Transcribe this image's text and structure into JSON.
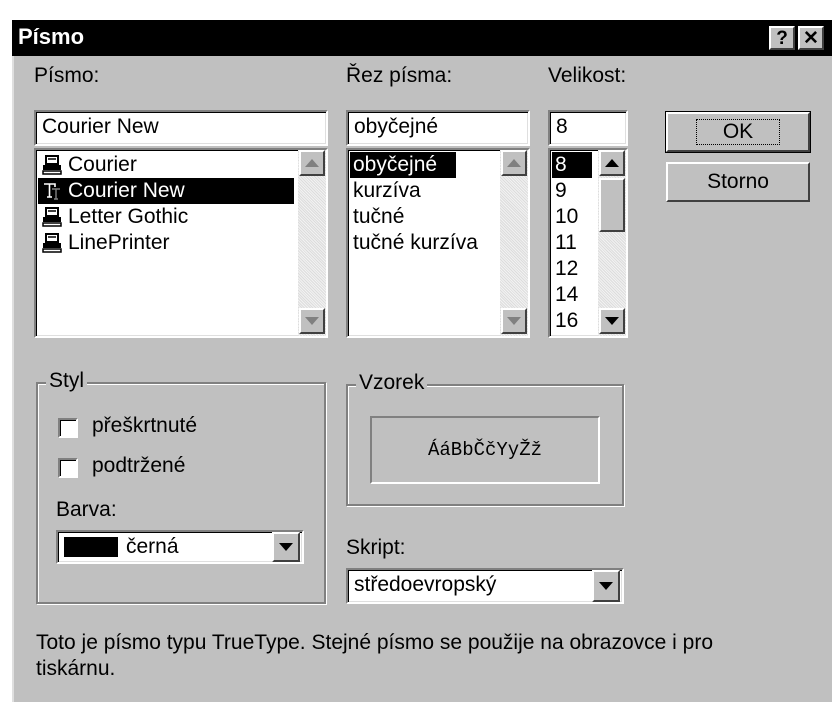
{
  "window": {
    "title": "Písmo",
    "help_button": "?",
    "close_button": "✕"
  },
  "font": {
    "label": "Písmo:",
    "label_underline": "P",
    "value": "Courier New",
    "items": [
      {
        "label": "Courier",
        "icon": "printer-font-icon",
        "selected": false
      },
      {
        "label": "Courier New",
        "icon": "truetype-font-icon",
        "selected": true
      },
      {
        "label": "Letter Gothic",
        "icon": "printer-font-icon",
        "selected": false
      },
      {
        "label": "LinePrinter",
        "icon": "printer-font-icon",
        "selected": false
      }
    ]
  },
  "style": {
    "label": "Řez písma:",
    "value": "obyčejné",
    "items": [
      {
        "label": "obyčejné",
        "selected": true
      },
      {
        "label": "kurzíva",
        "selected": false
      },
      {
        "label": "tučné",
        "selected": false
      },
      {
        "label": "tučné kurzíva",
        "selected": false
      }
    ]
  },
  "size": {
    "label": "Velikost:",
    "value": "8",
    "items": [
      {
        "label": "8",
        "selected": true
      },
      {
        "label": "9",
        "selected": false
      },
      {
        "label": "10",
        "selected": false
      },
      {
        "label": "11",
        "selected": false
      },
      {
        "label": "12",
        "selected": false
      },
      {
        "label": "14",
        "selected": false
      },
      {
        "label": "16",
        "selected": false
      }
    ]
  },
  "buttons": {
    "ok": "OK",
    "cancel": "Storno"
  },
  "effects": {
    "title": "Styl",
    "strikeout": "přeškrtnuté",
    "strikeout_checked": false,
    "underline": "podtržené",
    "underline_checked": false,
    "color_label": "Barva:",
    "color_value": "černá",
    "color_swatch": "#000000"
  },
  "sample": {
    "title": "Vzorek",
    "text": "ÁáBbČčYyŽž"
  },
  "script": {
    "label": "Skript:",
    "value": "středoevropský"
  },
  "description": "Toto je písmo typu TrueType. Stejné písmo se použije na obrazovce i pro tiskárnu.",
  "colors": {
    "dialog_bg": "#c0c0c0",
    "titlebar_bg": "#000000",
    "selection_bg": "#000000"
  }
}
